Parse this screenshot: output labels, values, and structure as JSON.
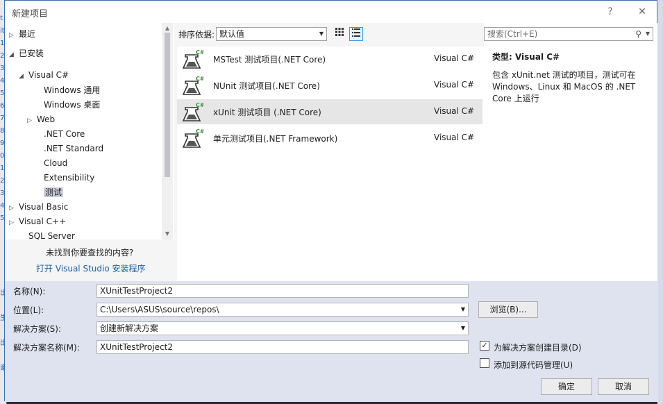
{
  "background": {
    "left_chars": [
      "t",
      "it",
      "1",
      "2",
      "3",
      "4",
      "5",
      "6",
      "7",
      "8",
      "9",
      "0",
      "1",
      "2",
      "3",
      "4",
      "5",
      "",
      "",
      "",
      "",
      "",
      "出",
      "",
      "生",
      "",
      "出",
      "",
      "谢"
    ]
  },
  "dialog": {
    "title": "新建项目",
    "help_icon": "?",
    "close_icon": "✕"
  },
  "tree": {
    "items": [
      {
        "label": "最近",
        "arrow": "▷",
        "selected": false
      },
      {
        "label": "已安装",
        "arrow": "◢",
        "selected": false
      },
      {
        "label": "Visual C#",
        "arrow": "◢",
        "selected": false
      },
      {
        "label": "Windows 通用",
        "arrow": "",
        "selected": false
      },
      {
        "label": "Windows 桌面",
        "arrow": "",
        "selected": false
      },
      {
        "label": "Web",
        "arrow": "▷",
        "selected": false
      },
      {
        "label": ".NET Core",
        "arrow": "",
        "selected": false
      },
      {
        "label": ".NET Standard",
        "arrow": "",
        "selected": false
      },
      {
        "label": "Cloud",
        "arrow": "",
        "selected": false
      },
      {
        "label": "Extensibility",
        "arrow": "",
        "selected": false
      },
      {
        "label": "测试",
        "arrow": "",
        "selected": true
      },
      {
        "label": "Visual Basic",
        "arrow": "▷",
        "selected": false
      },
      {
        "label": "Visual C++",
        "arrow": "▷",
        "selected": false
      },
      {
        "label": "SQL Server",
        "arrow": "",
        "selected": false
      }
    ],
    "not_found": "未找到你要查找的内容?",
    "open_installer": "打开 Visual Studio 安装程序"
  },
  "sort": {
    "label": "排序依据:",
    "value": "默认值"
  },
  "templates": [
    {
      "name": "MSTest 测试项目(.NET Core)",
      "lang": "Visual C#",
      "badge": "C#",
      "selected": false
    },
    {
      "name": "NUnit 测试项目(.NET Core)",
      "lang": "Visual C#",
      "badge": "C#",
      "selected": false
    },
    {
      "name": "xUnit 测试项目 (.NET Core)",
      "lang": "Visual C#",
      "badge": "C#",
      "selected": true
    },
    {
      "name": "单元测试项目(.NET Framework)",
      "lang": "Visual C#",
      "badge": "C#",
      "selected": false
    }
  ],
  "search": {
    "placeholder": "搜索(Ctrl+E)"
  },
  "detail": {
    "type": "类型:  Visual C#",
    "description": "包含 xUnit.net 测试的项目，测试可在 Windows、Linux 和 MacOS 的 .NET Core 上运行"
  },
  "form": {
    "name_label": "名称(N):",
    "name_value": "XUnitTestProject2",
    "location_label": "位置(L):",
    "location_value": "C:\\Users\\ASUS\\source\\repos\\",
    "solution_label": "解决方案(S):",
    "solution_value": "创建新解决方案",
    "solution_name_label": "解决方案名称(M):",
    "solution_name_value": "XUnitTestProject2",
    "browse_button": "浏览(B)...",
    "create_dir_label": "为解决方案创建目录(D)",
    "create_dir_checked": true,
    "add_source_control_label": "添加到源代码管理(U)",
    "add_source_control_checked": false,
    "ok_button": "确定",
    "cancel_button": "取消"
  },
  "colors": {
    "accent": "#3c6fb0",
    "link": "#1a5ea8",
    "csharp_badge": "#388a34",
    "bottom_panel": "#dee3ef"
  }
}
